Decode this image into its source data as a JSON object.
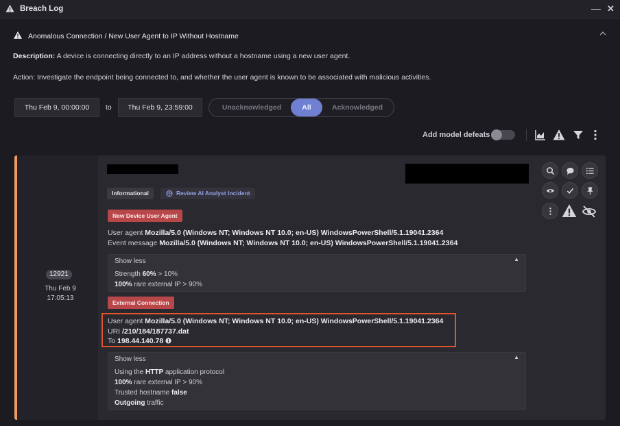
{
  "window": {
    "title": "Breach Log",
    "minimize": "—",
    "close": "✕"
  },
  "model": {
    "name": "Anomalous Connection / New User Agent to IP Without Hostname",
    "description_label": "Description:",
    "description": "A device is connecting directly to an IP address without a hostname using a new user agent.",
    "action": "Action: Investigate the endpoint being connected to, and whether the user agent is known to be associated with malicious activities."
  },
  "filters": {
    "from": "Thu Feb 9, 00:00:00",
    "to_label": "to",
    "to": "Thu Feb 9, 23:59:00",
    "ack_options": [
      "Unacknowledged",
      "All",
      "Acknowledged"
    ],
    "ack_selected": "All"
  },
  "toolbar": {
    "defeats_label": "Add model defeats",
    "defeats_enabled": false,
    "icons": [
      "chart-icon",
      "warning-icon",
      "filter-icon",
      "more-vertical-icon"
    ]
  },
  "breach": {
    "pbid": "12921",
    "date": "Thu Feb 9",
    "time": "17:05:13",
    "tags": {
      "info": "Informational",
      "ai": "Review AI Analyst Incident"
    },
    "section1": {
      "title": "New Device User Agent",
      "user_agent_label": "User agent",
      "user_agent": "Mozilla/5.0 (Windows NT; Windows NT 10.0; en-US) WindowsPowerShell/5.1.19041.2364",
      "event_label": "Event message",
      "event": "Mozilla/5.0 (Windows NT; Windows NT 10.0; en-US) WindowsPowerShell/5.1.19041.2364",
      "details": {
        "toggle": "Show less",
        "strength_label": "Strength",
        "strength": "60%",
        "strength_suffix": "> 10%",
        "rare_value": "100%",
        "rare_text": "rare external IP > 90%"
      }
    },
    "section2": {
      "title": "External Connection",
      "user_agent_label": "User agent",
      "user_agent": "Mozilla/5.0 (Windows NT; Windows NT 10.0; en-US) WindowsPowerShell/5.1.19041.2364",
      "uri_label": "URI",
      "uri": "/210/184/187737.dat",
      "to_label": "To",
      "to_ip": "198.44.140.78",
      "details": {
        "toggle": "Show less",
        "proto_pre": "Using the",
        "proto": "HTTP",
        "proto_post": "application protocol",
        "rare_value": "100%",
        "rare_text": "rare external IP > 90%",
        "trusted_label": "Trusted hostname",
        "trusted": "false",
        "outgoing": "Outgoing",
        "traffic": "traffic"
      }
    }
  },
  "colors": {
    "accent": "#f29a5e",
    "selected": "#6f7fd1",
    "highlight": "#e0532b",
    "tag_red": "#b8474a"
  }
}
